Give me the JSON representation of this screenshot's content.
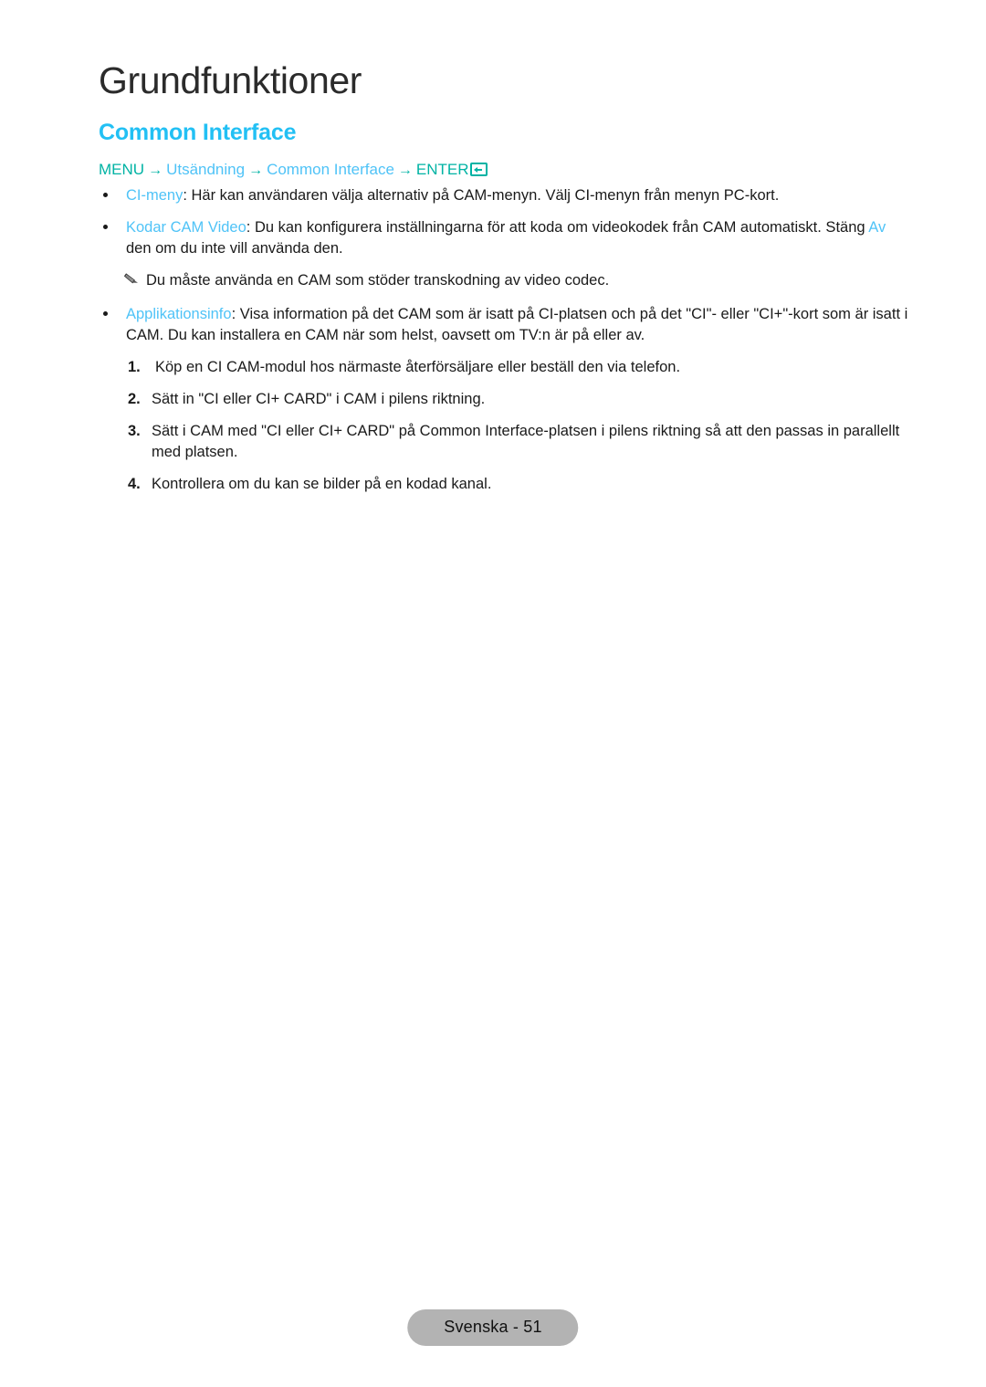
{
  "header": {
    "chapter_title": "Grundfunktioner",
    "section_title": "Common Interface"
  },
  "breadcrumb": {
    "menu_key": "MENU",
    "arrow": "→",
    "step_1": "Utsändning",
    "step_2": "Common Interface",
    "enter_key": "ENTER",
    "enter_icon": "enter-key-icon"
  },
  "content": {
    "bullets": [
      {
        "highlight": "CI-meny",
        "text_after": ": Här kan användaren välja alternativ på CAM-menyn. Välj CI-menyn från menyn PC-kort."
      },
      {
        "highlight": "Kodar CAM Video",
        "text_after": ": Du kan konfigurera inställningarna för att koda om videokodek från CAM automatiskt. Stäng ",
        "highlight_2": "Av",
        "text_end": " den om du inte vill använda den."
      },
      {
        "highlight": "Applikationsinfo",
        "text_after": ": Visa information på det CAM som är isatt på CI-platsen och på det \"CI\"- eller \"CI+\"-kort som är isatt i CAM. Du kan installera en CAM när som helst, oavsett om TV:n är på eller av."
      }
    ],
    "note": {
      "icon": "pencil-icon",
      "text": "Du måste använda en CAM som stöder transkodning av video codec."
    },
    "steps": [
      {
        "number": "1.",
        "text": "Köp en CI CAM-modul hos närmaste återförsäljare eller beställ den via telefon."
      },
      {
        "number": "2.",
        "text": "Sätt in \"CI eller CI+ CARD\" i CAM i pilens riktning."
      },
      {
        "number": "3.",
        "text": "Sätt i CAM med \"CI eller CI+ CARD\" på Common Interface-platsen i pilens riktning så att den passas in parallellt med platsen."
      },
      {
        "number": "4.",
        "text": "Kontrollera om du kan se bilder på en kodad kanal."
      }
    ]
  },
  "footer": {
    "page_label": "Svenska - 51"
  },
  "colors": {
    "accent_cyan": "#22c0f4",
    "link_blue": "#4fc3f7",
    "teal": "#00b3a4",
    "footer_bg": "#b3b3b3",
    "body_text": "#1a1a1a"
  }
}
